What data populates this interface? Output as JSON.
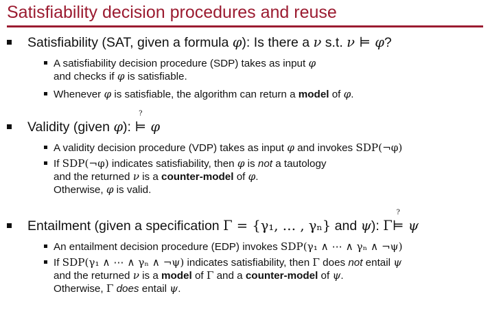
{
  "title": "Satisfiability decision procedures and reuse",
  "colors": {
    "title": "#9b1b30",
    "rule": "#9b1b30",
    "text": "#111111"
  },
  "sat": {
    "a": "Satisfiability (SAT, given a formula ",
    "phi": "φ",
    "b": "): Is there a ",
    "nu": "ν",
    "c": " s.t. ",
    "models": "ν ⊨ φ",
    "d": "?",
    "sub1_a": "A satisfiability decision procedure (SDP) takes as input ",
    "sub1_phi": "φ",
    "sub1_c": "and checks if ",
    "sub1_phi2": "φ",
    "sub1_d": " is satisfiable.",
    "sub2_a": "Whenever ",
    "sub2_phi": "φ",
    "sub2_b": " is satisfiable, the algorithm can return a ",
    "sub2_bold": "model",
    "sub2_c": " of ",
    "sub2_phi2": "φ",
    "sub2_d": "."
  },
  "validity": {
    "a": "Validity (given ",
    "phi": "φ",
    "b": "): ",
    "qmark": "?",
    "turnstile": "⊨",
    "phi2": " φ",
    "sub1_a": "A validity decision procedure (VDP) takes as input ",
    "sub1_phi": "φ",
    "sub1_b": " and invokes ",
    "sub1_call": "SDP(¬φ)",
    "sub2_a": "If ",
    "sub2_call": "SDP(¬φ)",
    "sub2_b": " indicates satisfiability, then ",
    "sub2_phi": "φ",
    "sub2_c": " is ",
    "sub2_not": "not",
    "sub2_d": " a tautology",
    "sub2_e": "and the returned ",
    "sub2_nu": "ν",
    "sub2_f": " is a ",
    "sub2_bold": "counter-model",
    "sub2_g": " of ",
    "sub2_phi2": "φ",
    "sub2_h": ".",
    "sub2_i": "Otherwise, ",
    "sub2_phi3": "φ",
    "sub2_j": " is valid."
  },
  "entailment": {
    "a": "Entailment (given a specification ",
    "gamma_set": "Γ = {γ₁, … , γₙ}",
    "b": " and ",
    "psi": "ψ",
    "c": "): ",
    "gamma": "Γ",
    "qmark": "?",
    "turnstile": "⊨",
    "psi2": " ψ",
    "sub1_a": "An entailment decision procedure (EDP) invokes ",
    "sub1_call": "SDP(γ₁ ∧ ⋯ ∧ γₙ ∧ ¬ψ)",
    "sub2_a": "If ",
    "sub2_call": "SDP(γ₁ ∧ ⋯ ∧ γₙ ∧ ¬ψ)",
    "sub2_b": " indicates satisfiability, then ",
    "sub2_gamma": "Γ",
    "sub2_c": " does ",
    "sub2_not": "not",
    "sub2_d": " entail ",
    "sub2_psi": "ψ",
    "sub2_e": "and the returned ",
    "sub2_nu": "ν",
    "sub2_f": " is a ",
    "sub2_model": "model",
    "sub2_g": " of ",
    "sub2_gamma2": "Γ",
    "sub2_h": " and a ",
    "sub2_cm": "counter-model",
    "sub2_i": " of ",
    "sub2_psi2": "ψ",
    "sub2_j": ".",
    "sub2_k": "Otherwise, ",
    "sub2_gamma3": "Γ",
    "sub2_does": "does",
    "sub2_l": " entail ",
    "sub2_psi3": "ψ",
    "sub2_m": "."
  }
}
